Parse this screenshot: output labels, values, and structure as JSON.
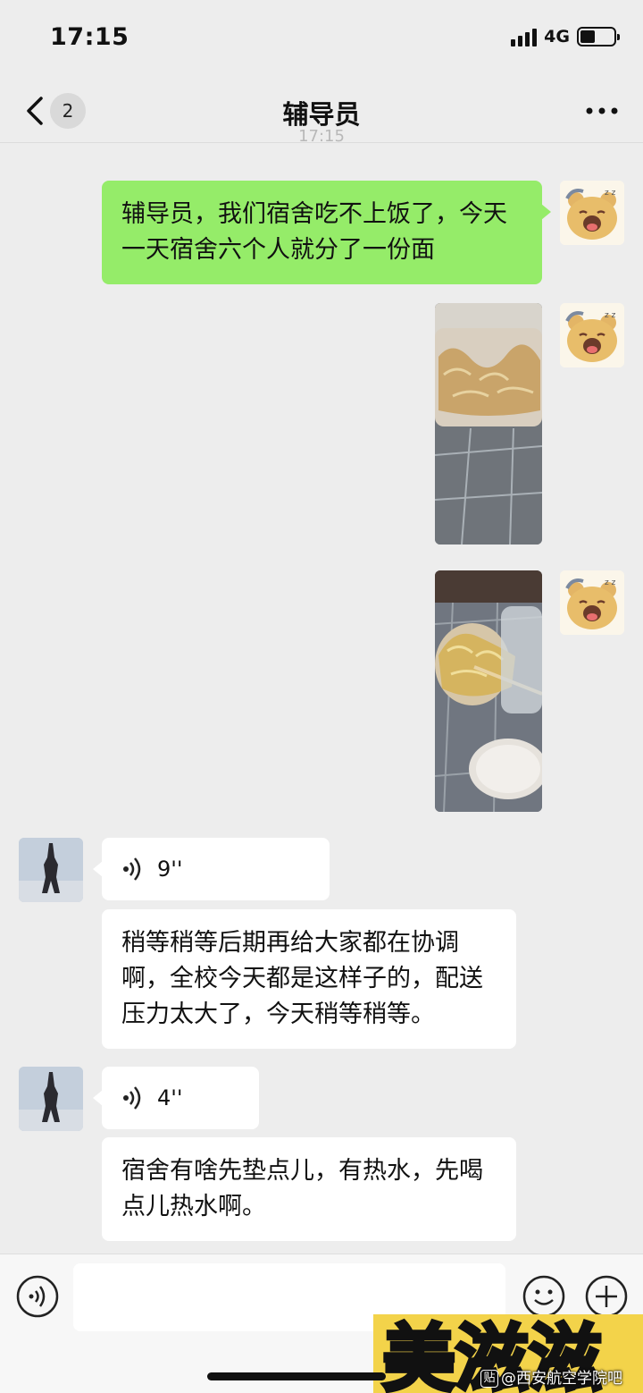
{
  "status_bar": {
    "time": "17:15",
    "network": "4G",
    "battery_level": 0.45
  },
  "header": {
    "back_badge": "2",
    "title": "辅导员"
  },
  "timestamp_faded": "17:15",
  "messages": {
    "sent_text": "辅导员，我们宿舍吃不上饭了，今天一天宿舍六个人就分了一份面",
    "voice_1_duration": "9''",
    "reply_1": "稍等稍等后期再给大家都在协调啊，全校今天都是这样子的，配送压力太大了，今天稍等稍等。",
    "voice_2_duration": "4''",
    "reply_2": "宿舍有啥先垫点儿，有热水，先喝点儿热水啊。"
  },
  "input_bar": {
    "placeholder": ""
  },
  "overlay": {
    "sticker_text": "美滋滋",
    "watermark": "@西安航空学院吧",
    "watermark_icon": "贴"
  },
  "colors": {
    "sent_bubble": "#95ec69",
    "received_bubble": "#ffffff",
    "background": "#ededed"
  }
}
